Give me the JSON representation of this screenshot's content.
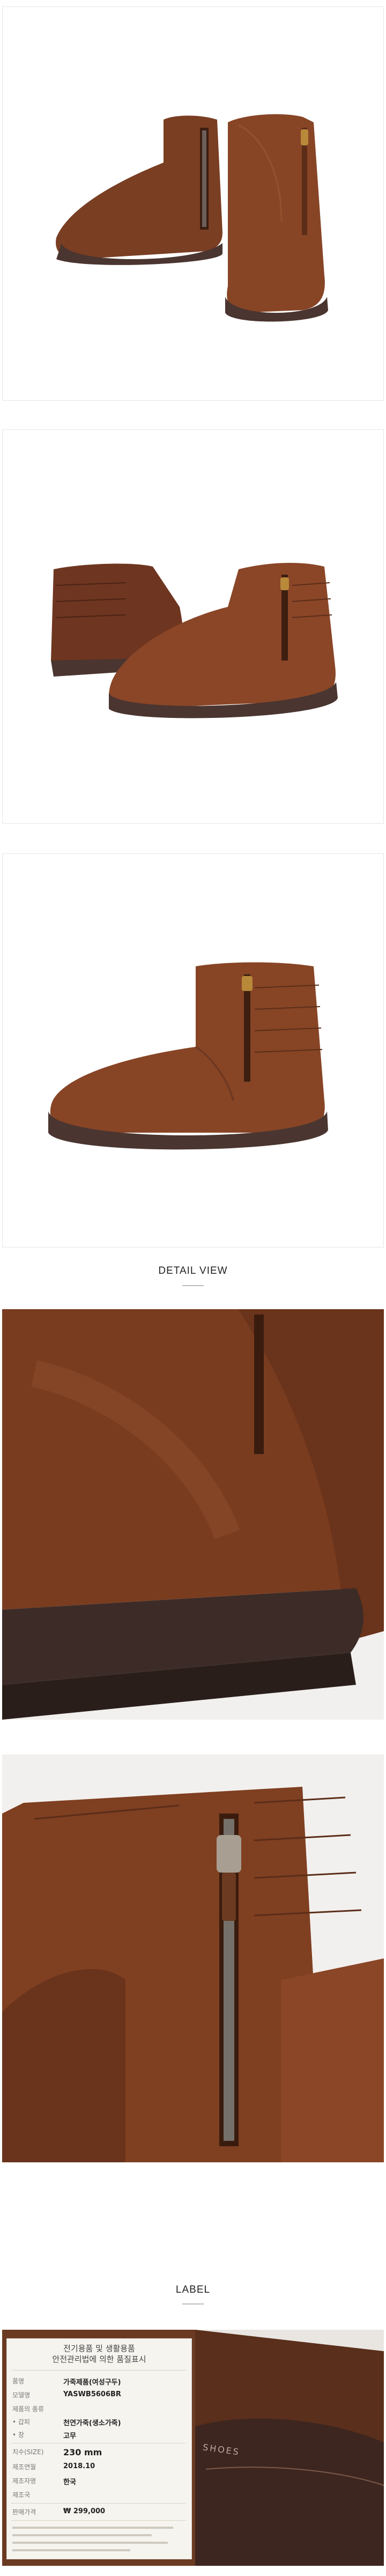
{
  "sections": {
    "detail_view_heading": "DETAIL VIEW",
    "label_heading": "LABEL"
  },
  "tag": {
    "title_line1": "전기용품 및 생활용품",
    "title_line2": "안전관리법에 의한 품질표시",
    "rows": [
      {
        "label": "품명",
        "value": "가죽제품(여성구두)"
      },
      {
        "label": "모델명",
        "value": "YASWB5606BR"
      },
      {
        "label": "제품의 종류",
        "value": ""
      },
      {
        "label": "• 갑피",
        "value": "천연가죽(생소가죽)"
      },
      {
        "label": "• 창",
        "value": "고무"
      },
      {
        "label": "치수(SIZE)",
        "value": "230 mm"
      },
      {
        "label": "제조연월",
        "value": "2018.10"
      },
      {
        "label": "제조자명",
        "value": "한국"
      },
      {
        "label": "제조국",
        "value": ""
      },
      {
        "label": "판매가격",
        "value": "₩ 299,000"
      }
    ],
    "brand_mark": "SHOES"
  },
  "colors": {
    "leather": "#7a3e23",
    "leather_dark": "#4e2412",
    "sole": "#4a3530",
    "background": "#ffffff"
  }
}
